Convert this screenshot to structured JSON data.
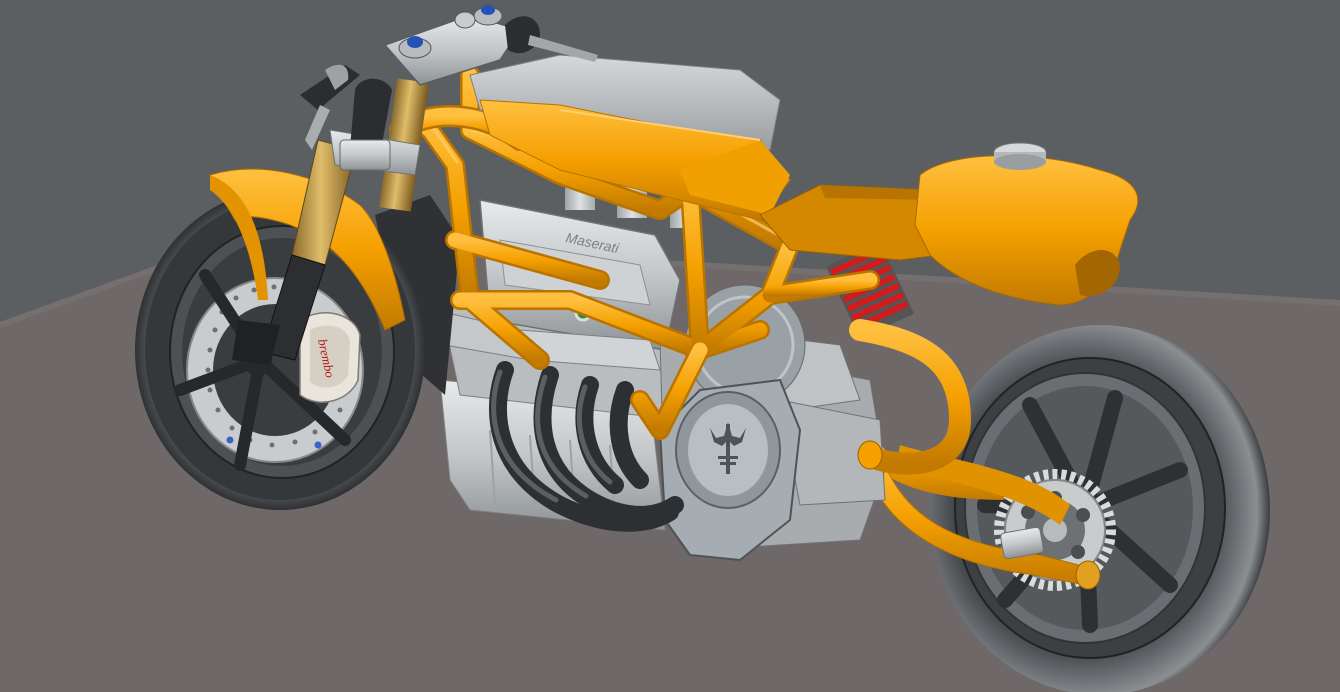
{
  "engine": {
    "brand_cast_label": "Maserati"
  },
  "brake_caliper": {
    "brand_label": "brembo"
  },
  "colors": {
    "background": "#5c5f61",
    "ground_plane": "#6f6868",
    "frame_orange": "#f5a000",
    "engine_aluminum": "#c8ccce",
    "tire_rubber": "#3c3e40",
    "spring_red": "#d41a1a"
  }
}
